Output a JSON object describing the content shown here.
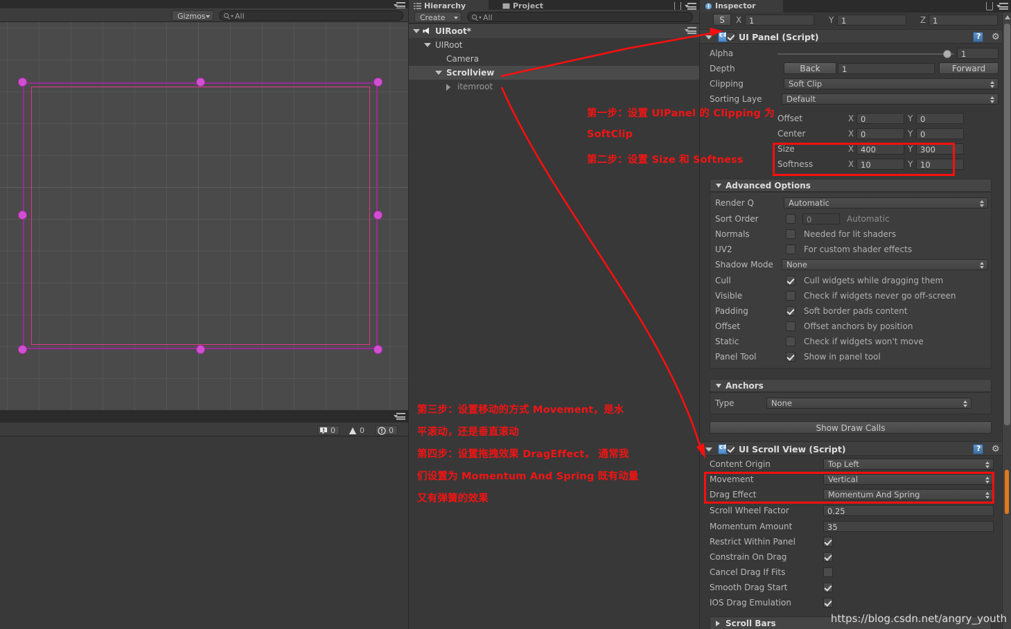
{
  "scene": {
    "gizmos_label": "Gizmos",
    "search_placeholder": "All",
    "search_value": ""
  },
  "console": {
    "errors": "0",
    "warnings": "0",
    "logs": "0"
  },
  "hierarchy": {
    "tab_label": "Hierarchy",
    "project_tab_label": "Project",
    "create_label": "Create",
    "search_placeholder": "All",
    "items": [
      {
        "label": "UIRoot*",
        "depth": 0,
        "arrow": "down",
        "kind": "scene"
      },
      {
        "label": "UIRoot",
        "depth": 1,
        "arrow": "down",
        "kind": "go"
      },
      {
        "label": "Camera",
        "depth": 2,
        "arrow": "none",
        "kind": "go"
      },
      {
        "label": "Scrollview",
        "depth": 2,
        "arrow": "down",
        "kind": "go-selected"
      },
      {
        "label": "itemroot",
        "depth": 3,
        "arrow": "right",
        "kind": "go-dim"
      }
    ]
  },
  "inspector": {
    "tab_label": "Inspector",
    "scale": {
      "prefix": "S",
      "x_label": "X",
      "x": "1",
      "y_label": "Y",
      "y": "1",
      "z_label": "Z",
      "z": "1"
    },
    "ui_panel": {
      "title": "UI Panel (Script)",
      "enabled": true,
      "alpha_label": "Alpha",
      "alpha_value": "1",
      "depth_label": "Depth",
      "depth_back": "Back",
      "depth_value": "1",
      "depth_forward": "Forward",
      "clipping_label": "Clipping",
      "clipping_value": "Soft Clip",
      "sorting_layer_label": "Sorting Laye",
      "sorting_layer_value": "Default",
      "offset_label": "Offset",
      "offset_x": "0",
      "offset_y": "0",
      "center_label": "Center",
      "center_x": "0",
      "center_y": "0",
      "size_label": "Size",
      "size_x": "400",
      "size_y": "300",
      "softness_label": "Softness",
      "softness_x": "10",
      "softness_y": "10",
      "advanced_label": "Advanced Options",
      "render_q_label": "Render Q",
      "render_q_value": "Automatic",
      "sort_order_label": "Sort Order",
      "sort_order_value": "0",
      "sort_order_hint": "Automatic",
      "sort_order_checked": false,
      "normals_label": "Normals",
      "normals_hint": "Needed for lit shaders",
      "normals_checked": false,
      "uv2_label": "UV2",
      "uv2_hint": "For custom shader effects",
      "uv2_checked": false,
      "shadow_mode_label": "Shadow Mode",
      "shadow_mode_value": "None",
      "cull_label": "Cull",
      "cull_hint": "Cull widgets while dragging them",
      "cull_checked": true,
      "visible_label": "Visible",
      "visible_hint": "Check if widgets never go off-screen",
      "visible_checked": false,
      "padding_label": "Padding",
      "padding_hint": "Soft border pads content",
      "padding_checked": true,
      "offset2_label": "Offset",
      "offset2_hint": "Offset anchors by position",
      "offset2_checked": false,
      "static_label": "Static",
      "static_hint": "Check if widgets won't move",
      "static_checked": false,
      "panel_tool_label": "Panel Tool",
      "panel_tool_hint": "Show in panel tool",
      "panel_tool_checked": true,
      "anchors_label": "Anchors",
      "type_label": "Type",
      "type_value": "None",
      "show_draw_calls": "Show Draw Calls"
    },
    "ui_scroll_view": {
      "title": "UI Scroll View (Script)",
      "enabled": true,
      "content_origin_label": "Content Origin",
      "content_origin_value": "Top Left",
      "movement_label": "Movement",
      "movement_value": "Vertical",
      "drag_effect_label": "Drag Effect",
      "drag_effect_value": "Momentum And Spring",
      "scroll_wheel_factor_label": "Scroll Wheel Factor",
      "scroll_wheel_factor_value": "0.25",
      "momentum_amount_label": "Momentum Amount",
      "momentum_amount_value": "35",
      "restrict_within_panel_label": "Restrict Within Panel",
      "restrict_within_panel_checked": true,
      "constrain_on_drag_label": "Constrain On Drag",
      "constrain_on_drag_checked": true,
      "cancel_drag_if_fits_label": "Cancel Drag If Fits",
      "cancel_drag_if_fits_checked": false,
      "smooth_drag_start_label": "Smooth Drag Start",
      "smooth_drag_start_checked": true,
      "ios_drag_emulation_label": "IOS Drag Emulation",
      "ios_drag_emulation_checked": true,
      "scroll_bars_label": "Scroll Bars"
    }
  },
  "annotations": {
    "step1_line1": "第一步：设置 UIPanel 的 Clipping 为",
    "step1_line2": "SoftClip",
    "step2_line1": "第二步：设置 Size 和 Softness",
    "step3_line1": "第三步：设置移动的方式 Movement，是水",
    "step3_line2": "平滚动，还是垂直滚动",
    "step4_line1": "第四步：设置拖拽效果 DragEffect， 通常我",
    "step4_line2": "们设置为 Momentum And Spring 既有动量",
    "step4_line3": "又有弹簧的效果",
    "color": "#f21414"
  },
  "watermark": "https://blog.csdn.net/angry_youth"
}
